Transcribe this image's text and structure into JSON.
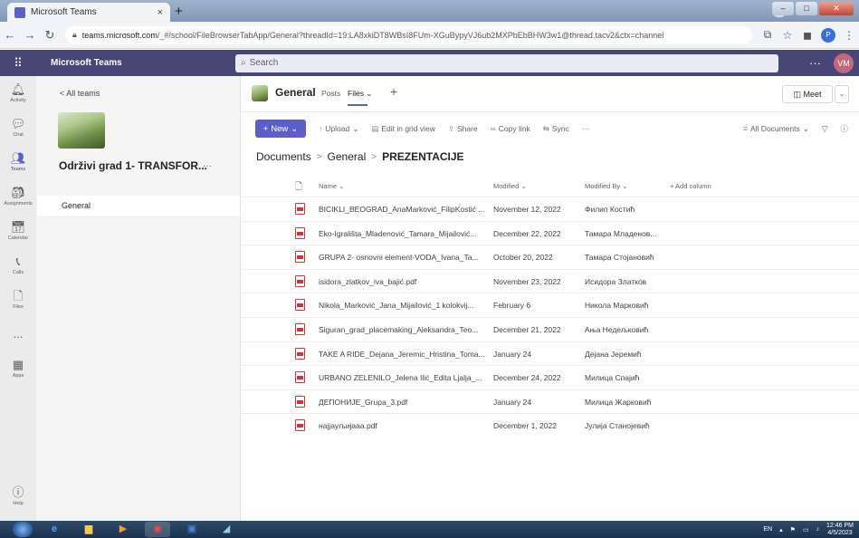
{
  "browser": {
    "tab_title": "Microsoft Teams",
    "tab_close": "×",
    "new_tab": "+",
    "url_host": "teams.microsoft.com",
    "url_path": "/_#/school/FileBrowserTabApp/General?threadId=19:LA8xkiDT8WBsI8FUm-XGuBypyVJ6ub2MXPbEbBHW3w1@thread.tacv2&ctx=channel",
    "profile_initial": "P",
    "window_profile": "⌄"
  },
  "teams": {
    "app_title": "Microsoft Teams",
    "search_placeholder": "Search",
    "more": "···",
    "user_initials": "VM"
  },
  "rail": [
    {
      "label": "Activity",
      "icon": "bell-icon"
    },
    {
      "label": "Chat",
      "icon": "chat-icon"
    },
    {
      "label": "Teams",
      "icon": "teams-icon"
    },
    {
      "label": "Assignments",
      "icon": "assignments-icon"
    },
    {
      "label": "Calendar",
      "icon": "calendar-icon"
    },
    {
      "label": "Calls",
      "icon": "phone-icon"
    },
    {
      "label": "Files",
      "icon": "file-icon"
    },
    {
      "label": "...",
      "icon": "more-icon"
    },
    {
      "label": "Apps",
      "icon": "apps-icon"
    }
  ],
  "rail_help": "Help",
  "teampanel": {
    "back": "< All teams",
    "team_name": "Održivi grad 1- TRANSFOR...",
    "team_more": "···",
    "channel": "General"
  },
  "channel": {
    "title": "General",
    "tab_posts": "Posts",
    "tab_files": "Files",
    "tab_files_caret": "⌄",
    "tab_add": "+",
    "meet": "Meet",
    "meet_caret": "⌄"
  },
  "commands": {
    "new": "New",
    "upload": "Upload",
    "edit_grid": "Edit in grid view",
    "share": "Share",
    "copy_link": "Copy link",
    "sync": "Sync",
    "more": "···",
    "all_documents": "All Documents"
  },
  "breadcrumb": [
    "Documents",
    "General",
    "PREZENTACIJE"
  ],
  "columns": {
    "name": "Name",
    "modified": "Modified",
    "modified_by": "Modified By",
    "add_column": "+ Add column"
  },
  "files": [
    {
      "name": "BICIKLI_BEOGRAD_AnaMarković_FilipKostić ...",
      "modified": "November 12, 2022",
      "by": "Филип Костић"
    },
    {
      "name": "Eko-Igrališta_Mladenović_Tamara_Mijailović...",
      "modified": "December 22, 2022",
      "by": "Тамара Младенов..."
    },
    {
      "name": "GRUPA 2- osnovni element-VODA_Ivana_Ta...",
      "modified": "October 20, 2022",
      "by": "Тамара Стојановић"
    },
    {
      "name": "isidora_zlatkov_iva_bajić.pdf",
      "modified": "November 23, 2022",
      "by": "Исидора Златков"
    },
    {
      "name": "Nikola_Marković_Jana_Mijailović_1 kolokvij...",
      "modified": "February 6",
      "by": "Никола Марковић"
    },
    {
      "name": "Siguran_grad_placemaking_Aleksandra_Teo...",
      "modified": "December 21, 2022",
      "by": "Ања Недељковић"
    },
    {
      "name": "TAKE A RIDE_Dejana_Jeremic_Hristina_Toma...",
      "modified": "January 24",
      "by": "Дејана Јеремић"
    },
    {
      "name": "URBANO ZELENILO_Jelena Ilić_Edita Ljalja_...",
      "modified": "December 24, 2022",
      "by": "Милица Спајић"
    },
    {
      "name": "ДЕПОНИЈЕ_Grupa_3.pdf",
      "modified": "January 24",
      "by": "Милица Жарковић"
    },
    {
      "name": "најјауљијааа.pdf",
      "modified": "December 1, 2022",
      "by": "Јулија Станојевић"
    }
  ],
  "taskbar": {
    "lang": "EN",
    "time": "12:46 PM",
    "date": "4/5/2023"
  }
}
